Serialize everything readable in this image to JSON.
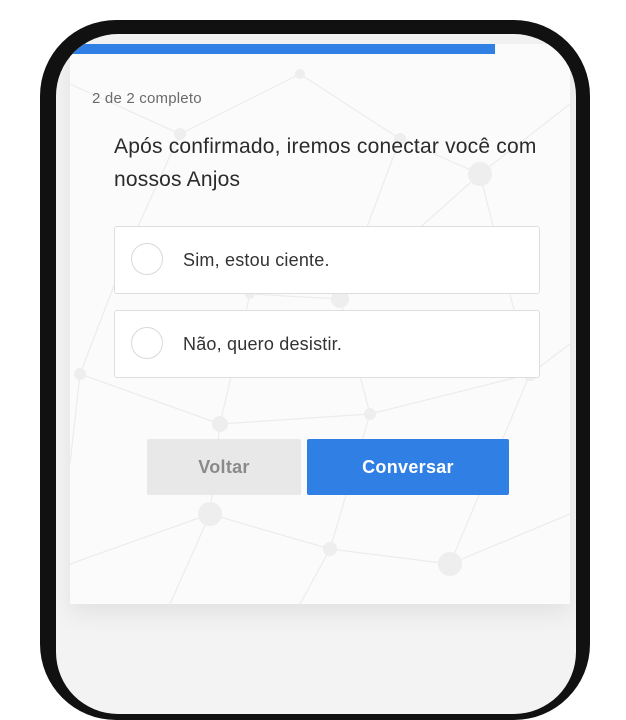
{
  "progress": {
    "label": "2 de 2 completo",
    "fraction": 0.85
  },
  "question": {
    "text": "Após confirmado, iremos conectar você com nossos Anjos"
  },
  "options": [
    {
      "label": "Sim, estou ciente.",
      "selected": false
    },
    {
      "label": "Não, quero desistir.",
      "selected": false
    }
  ],
  "buttons": {
    "back_label": "Voltar",
    "continue_label": "Conversar"
  },
  "colors": {
    "accent": "#2f7fe5",
    "back_button": "#e8e8e8",
    "frame": "#111111"
  }
}
